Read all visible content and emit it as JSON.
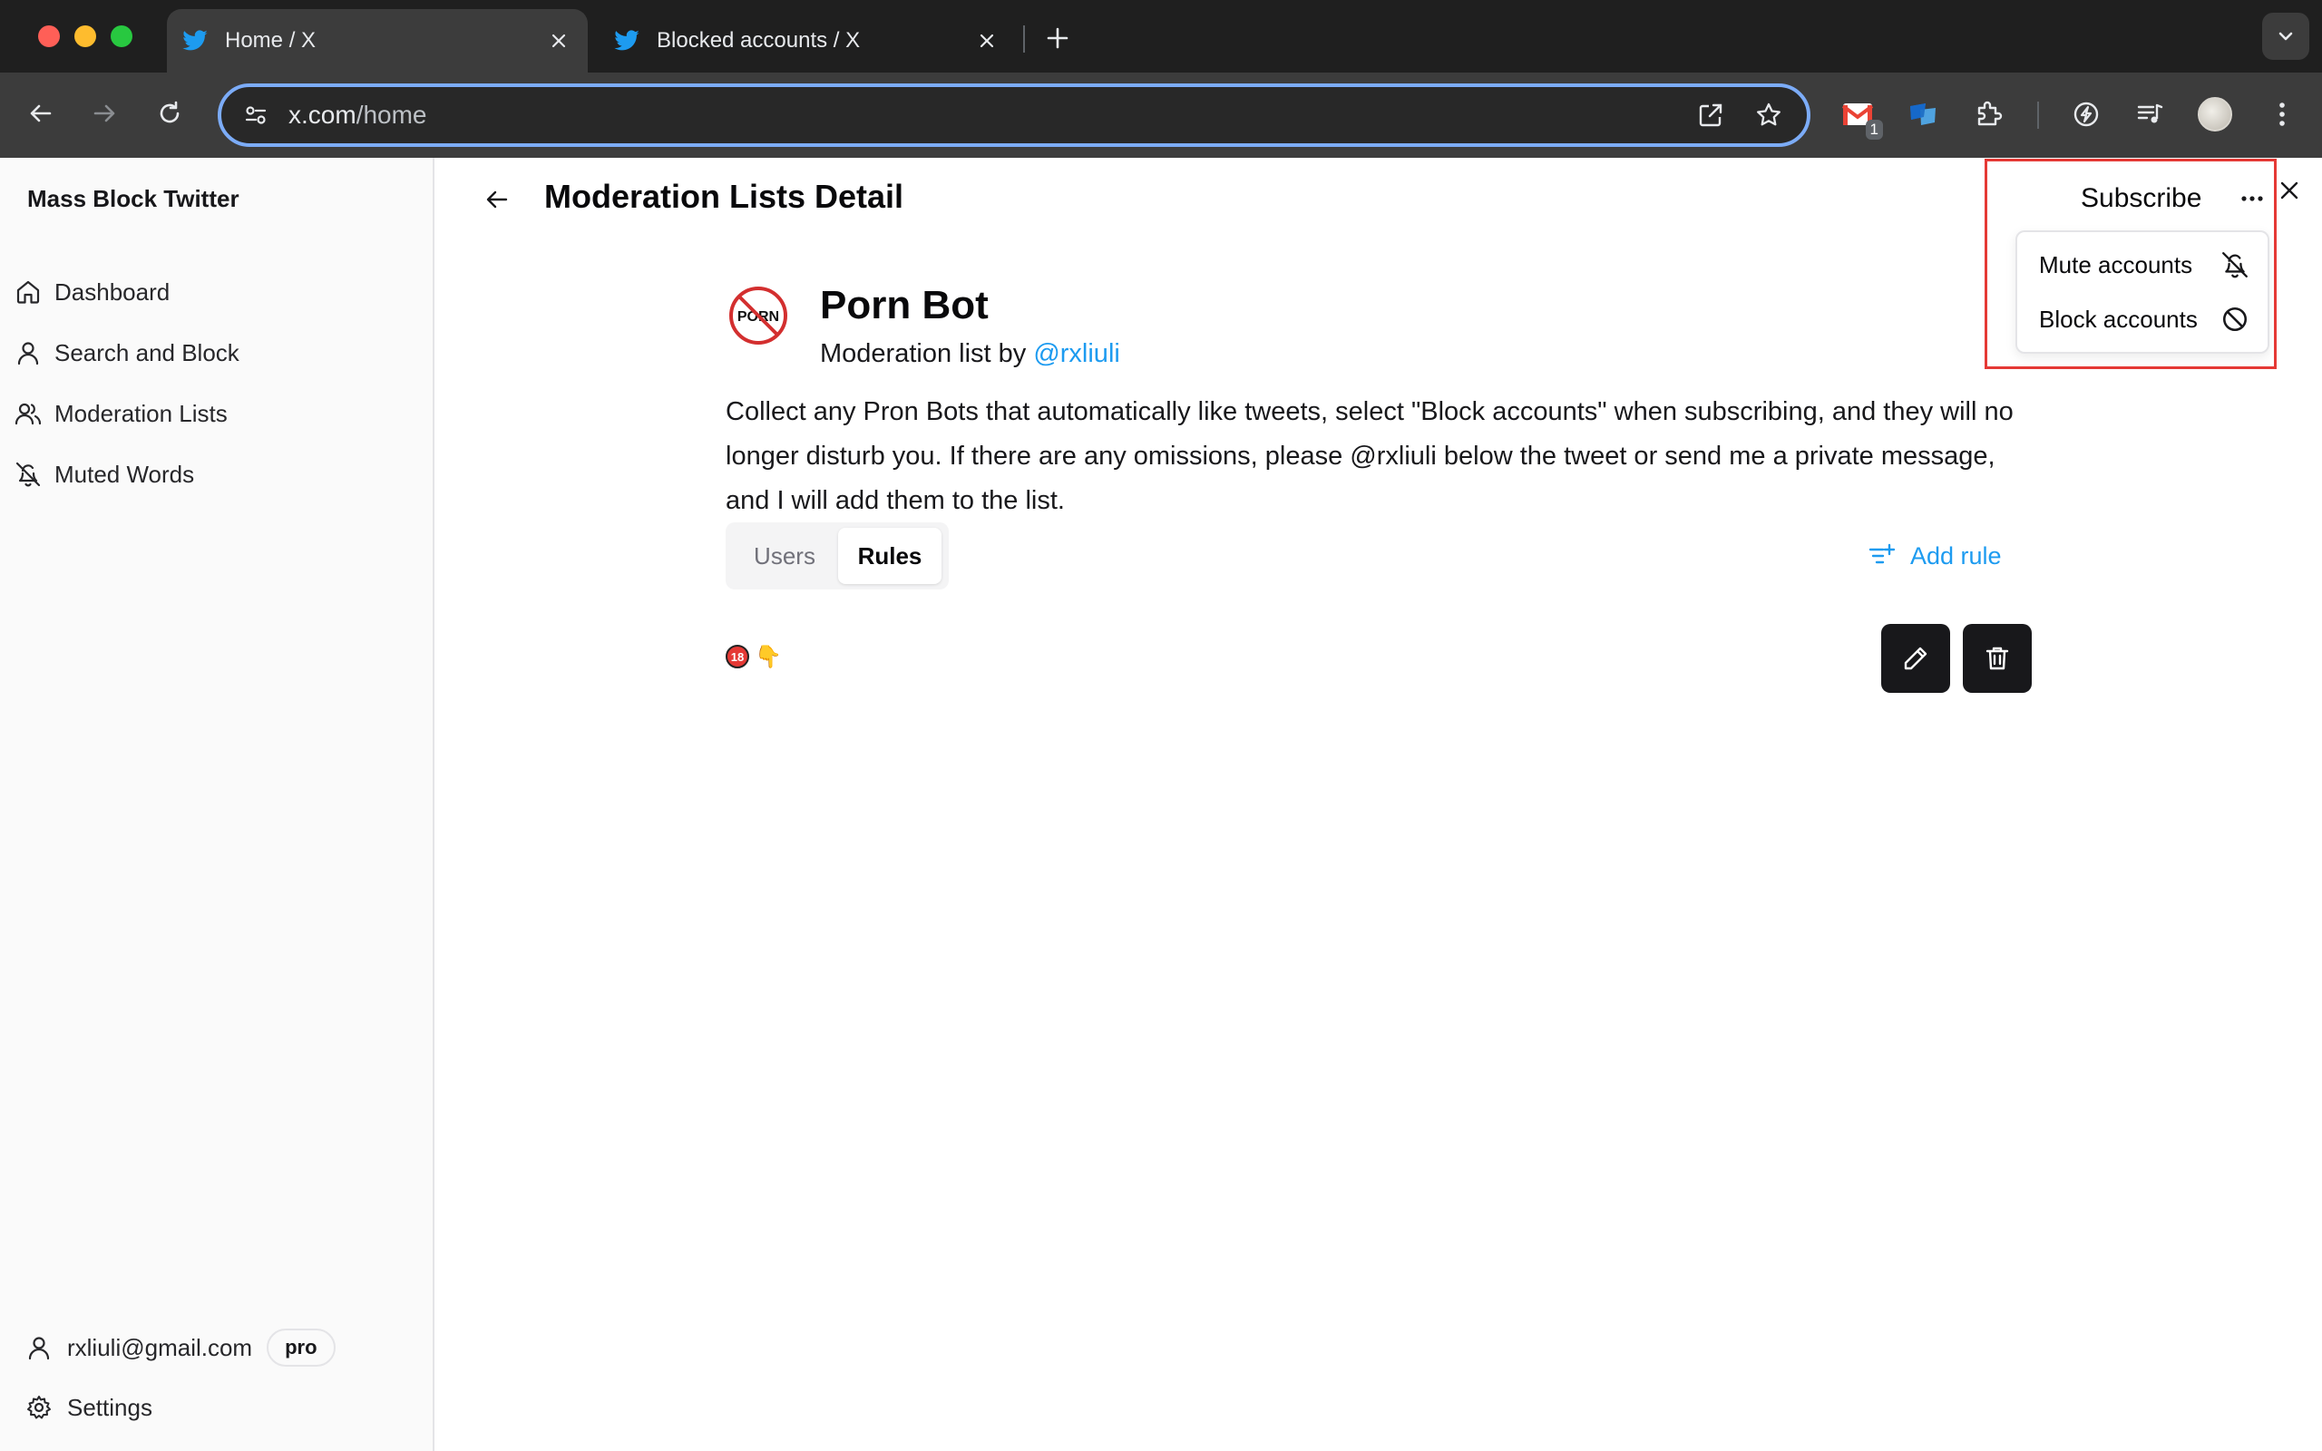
{
  "browser": {
    "tabs": [
      {
        "title": "Home / X",
        "active": true,
        "icon": "twitter-bird-icon"
      },
      {
        "title": "Blocked accounts / X",
        "active": false,
        "icon": "twitter-bird-icon"
      }
    ],
    "url_host": "x.com",
    "url_path": "/home",
    "extension_badge": "1",
    "colors": {
      "focus_ring": "#7cacf8",
      "tab_bg": "#3c3c3c",
      "frame_bg": "#1f1f1f"
    }
  },
  "sidebar": {
    "brand": "Mass Block Twitter",
    "items": [
      {
        "label": "Dashboard",
        "icon": "home-icon"
      },
      {
        "label": "Search and Block",
        "icon": "user-icon"
      },
      {
        "label": "Moderation Lists",
        "icon": "users-icon"
      },
      {
        "label": "Muted Words",
        "icon": "bell-off-icon"
      }
    ],
    "user_email": "rxliuli@gmail.com",
    "plan_badge": "pro",
    "settings_label": "Settings"
  },
  "header": {
    "title": "Moderation Lists Detail",
    "subscribe_label": "Subscribe"
  },
  "list": {
    "name": "Porn Bot",
    "avatar_text": "PORN",
    "by_prefix": "Moderation list by ",
    "author_handle": "@rxliuli",
    "description": "Collect any Pron Bots that automatically like tweets, select \"Block accounts\" when subscribing, and they will no longer disturb you. If there are any omissions, please @rxliuli below the tweet or send me a private message, and I will add them to the list."
  },
  "tabs": {
    "users_label": "Users",
    "rules_label": "Rules",
    "selected": "Rules"
  },
  "rules": {
    "add_rule_label": "Add rule",
    "items": [
      {
        "emoji_badge": "18",
        "emoji_hand": "👇"
      }
    ]
  },
  "dropdown": {
    "items": [
      {
        "label": "Mute accounts",
        "icon": "bell-off-icon"
      },
      {
        "label": "Block accounts",
        "icon": "ban-icon"
      }
    ]
  },
  "colors": {
    "accent": "#1d9bf0",
    "highlight": "#e53935",
    "button_dark": "#18181b"
  }
}
